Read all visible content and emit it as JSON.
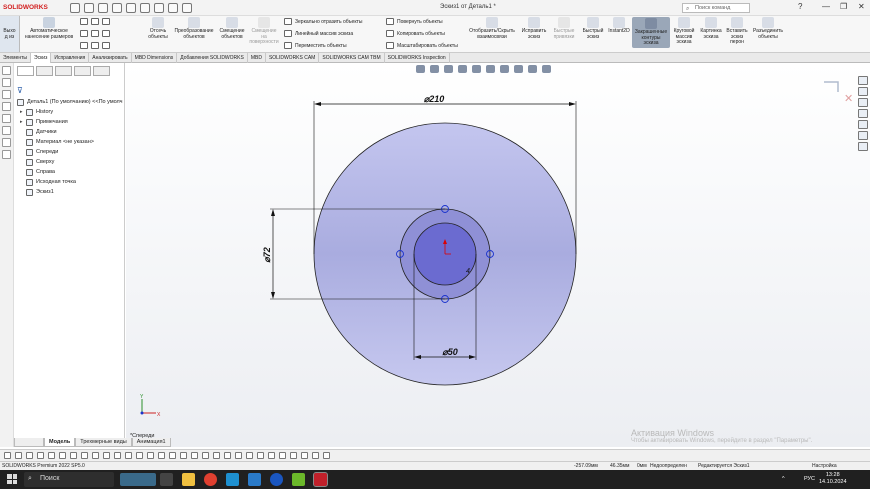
{
  "app": {
    "logo": "SOLIDWORKS",
    "document_title": "Эскиз1 от Деталь1 *",
    "search_placeholder": "Поиск команд",
    "window_controls": [
      "?",
      "—",
      "❐",
      "✕"
    ]
  },
  "ribbon": {
    "exit_sketch": "Выхо\nд из",
    "smart_dimension": "Автоматическое\nнанесение размеров",
    "buttons": [
      {
        "label": "Отсечь\nобъекты"
      },
      {
        "label": "Преобразование\nобъектов"
      },
      {
        "label": "Смещение\nобъектов"
      },
      {
        "label": "Смещение\nна\nповерхности"
      },
      {
        "label": "Отобразить/Скрыть\nвзаимосвязи"
      },
      {
        "label": "Исправить\nэскиз"
      },
      {
        "label": "Быстрые\nпривязки"
      },
      {
        "label": "Быстрый\nэскиз"
      },
      {
        "label": "Instant2D"
      },
      {
        "label": "Закрашенные\nконтуры\nэскиза"
      },
      {
        "label": "Круговой\nмассив\nэскиза"
      },
      {
        "label": "Картинка\nэскиза"
      },
      {
        "label": "Вставить\nэскиз\nперон"
      },
      {
        "label": "Разъединить\nобъекты"
      }
    ],
    "small_commands": [
      "Зеркально отразить объекты",
      "Линейный массив эскиза",
      "Переместить объекты",
      "Повернуть объекты",
      "Копировать объекты",
      "Масштабировать объекты"
    ]
  },
  "command_tabs": [
    "Элементы",
    "Эскиз",
    "Исправления",
    "Анализировать",
    "MBD Dimensions",
    "Добавления SOLIDWORKS",
    "MBD",
    "SOLIDWORKS CAM",
    "SOLIDWORKS CAM TBM",
    "SOLIDWORKS Inspection"
  ],
  "feature_tree": {
    "root": "Деталь1 (По умолчанию) <<По умолч",
    "items": [
      {
        "label": "History",
        "expandable": true
      },
      {
        "label": "Примечания",
        "expandable": true
      },
      {
        "label": "Датчики",
        "expandable": false
      },
      {
        "label": "Материал <не указан>",
        "expandable": false
      },
      {
        "label": "Спереди",
        "expandable": false
      },
      {
        "label": "Сверху",
        "expandable": false
      },
      {
        "label": "Справа",
        "expandable": false
      },
      {
        "label": "Исходная точка",
        "expandable": false
      },
      {
        "label": "Эскиз1",
        "expandable": false
      }
    ]
  },
  "bottom_tabs": [
    "Модель",
    "Трехмерные виды",
    "Анимация1"
  ],
  "view_label": "*Спереди",
  "sketch": {
    "dimensions": {
      "outer": "⌀210",
      "middle": "⌀72",
      "inner": "⌀50",
      "relation_mark": "4"
    },
    "triad": {
      "x": "X",
      "y": "Y"
    }
  },
  "activation": {
    "title": "Активация Windows",
    "subtitle": "Чтобы активировать Windows, перейдите в раздел \"Параметры\"."
  },
  "status": {
    "product": "SOLIDWORKS Premium 2022 SP5.0",
    "x_coord": "-257.09мм",
    "y_coord": "46.35мм",
    "z_coord": "0мм",
    "state": "Недоопределен",
    "editing": "Редактируется Эскиз1",
    "units": "Настройка"
  },
  "taskbar": {
    "search": "Поиск",
    "lang": "РУС",
    "time": "13:28",
    "date": "14.10.2024"
  },
  "colors": {
    "brand": "#d21f1f",
    "sketch_fill": "#b5b8e8",
    "sketch_inner": "#6c6cd4",
    "dim_line": "#111111",
    "point": "#1a33cc"
  }
}
